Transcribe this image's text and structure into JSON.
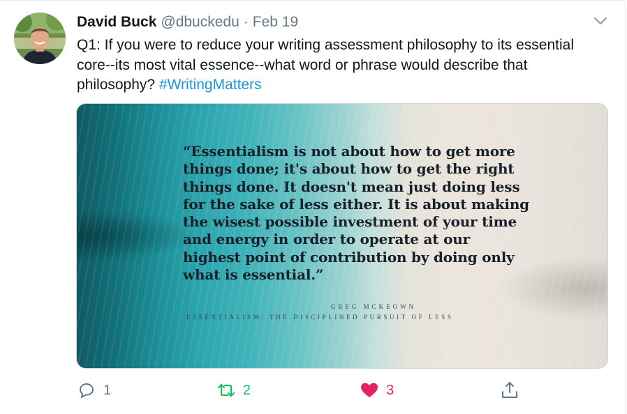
{
  "tweet": {
    "author_name": "David Buck",
    "handle": "@dbuckedu",
    "separator": "·",
    "date": "Feb 19",
    "text_main": "Q1: If you were to reduce your writing assessment philosophy to its essential core--its most vital essence--what word or phrase would describe that philosophy?",
    "hashtag": "#WritingMatters"
  },
  "media": {
    "quote": "“Essentialism is not about how to get more things done; it's about how to get the right things done. It doesn't mean just doing less for the sake of less either. It is about making the wisest possible investment of your time and energy in order to operate at our highest point of contribution by doing only what is essential.”",
    "author": "GREG MCKEOWN",
    "book": "ESSENTIALISM: THE DISCIPLINED PURSUIT OF LESS"
  },
  "actions": {
    "reply_count": "1",
    "retweet_count": "2",
    "like_count": "3"
  },
  "icons": {
    "reply": "reply-icon",
    "retweet": "retweet-icon",
    "like": "heart-icon",
    "share": "share-icon",
    "more": "chevron-down-icon"
  },
  "colors": {
    "hashtag": "#1b95e0",
    "retweet_active": "#17bf63",
    "like_active": "#e0245e",
    "muted": "#657786"
  }
}
